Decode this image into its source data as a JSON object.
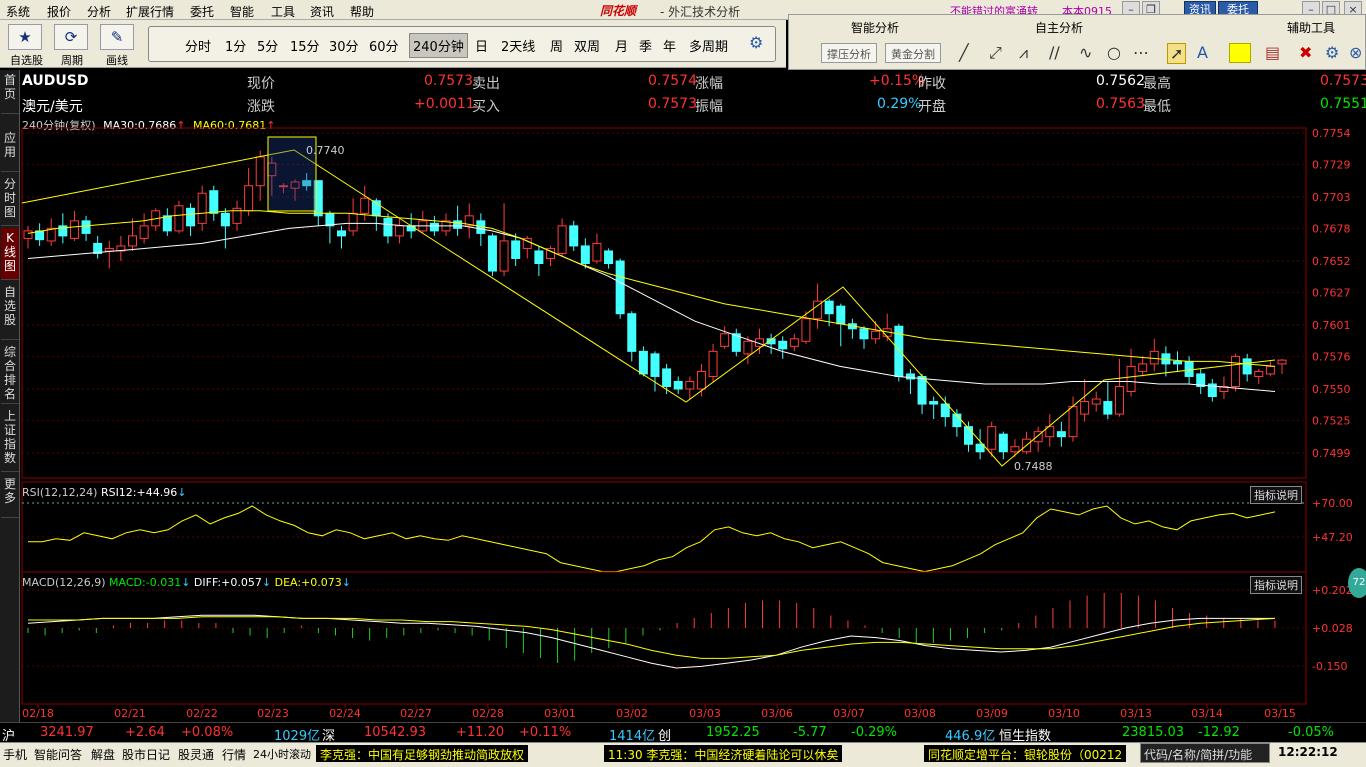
{
  "menu": {
    "items": [
      "系统",
      "报价",
      "分析",
      "扩展行情",
      "委托",
      "智能",
      "工具",
      "资讯",
      "帮助"
    ],
    "brand": "同花顺",
    "app_title": "- 外汇技术分析",
    "promo": "不能错过的富涌转",
    "account": "本本0915",
    "btn_news": "资讯",
    "btn_trade": "委托"
  },
  "toolbar": {
    "labels": [
      "自选股",
      "周期",
      "画线"
    ],
    "periods": [
      "分时",
      "1分",
      "5分",
      "15分",
      "30分",
      "60分",
      "240分钟",
      "日",
      "2天线",
      "周",
      "双周",
      "月",
      "季",
      "年",
      "多周期"
    ],
    "active": "240分钟"
  },
  "right_panel": {
    "headers": [
      "智能分析",
      "自主分析",
      "辅助工具"
    ],
    "buttons": [
      "撑压分析",
      "黄金分割"
    ]
  },
  "sidebar": {
    "tabs": [
      "首页",
      "应用",
      "分时图",
      "K线图",
      "自选股",
      "综合排名",
      "上证指数",
      "更多"
    ]
  },
  "quote": {
    "code": "AUDUSD",
    "name": "澳元/美元",
    "price_label": "现价",
    "price": "0.7573",
    "change_label": "涨跌",
    "change": "+0.0011",
    "sell_label": "卖出",
    "sell": "0.7574",
    "buy_label": "买入",
    "buy": "0.7573",
    "pct_label": "涨幅",
    "pct": "+0.15%",
    "amp_label": "振幅",
    "amp": "0.29%",
    "prev_label": "昨收",
    "prev": "0.7562",
    "open_label": "开盘",
    "open": "0.7563",
    "high_label": "最高",
    "high": "0.7573",
    "low_label": "最低",
    "low": "0.7551"
  },
  "ma": {
    "period": "240分钟(复权)",
    "ma30_label": "MA30:",
    "ma30": "0.7686",
    "ma60_label": "MA60:",
    "ma60": "0.7681"
  },
  "rsi": {
    "title": "RSI(12,12,24)",
    "line": "RSI12:",
    "value": "+44.96",
    "hint": "指标说明",
    "ticks": [
      "+70.00",
      "+47.20"
    ]
  },
  "macd": {
    "title": "MACD(12,26,9)",
    "macd_label": "MACD:",
    "macd": "-0.031",
    "diff_label": "DIFF:",
    "diff": "+0.057",
    "dea_label": "DEA:",
    "dea": "+0.073",
    "hint": "指标说明",
    "ticks": [
      "+0.202",
      "+0.028",
      "-0.150"
    ]
  },
  "chart_data": {
    "type": "candlestick",
    "ylim": [
      0.7474,
      0.7754
    ],
    "y_ticks": [
      "0.7754",
      "0.7729",
      "0.7703",
      "0.7678",
      "0.7652",
      "0.7627",
      "0.7601",
      "0.7576",
      "0.7550",
      "0.7525",
      "0.7499"
    ],
    "x_ticks": [
      "02/18",
      "02/21",
      "02/22",
      "02/23",
      "02/24",
      "02/27",
      "02/28",
      "03/01",
      "03/02",
      "03/03",
      "03/06",
      "03/07",
      "03/08",
      "03/09",
      "03/10",
      "03/13",
      "03/14",
      "03/15"
    ],
    "annotations": [
      {
        "text": "0.7740",
        "value": 0.774
      },
      {
        "text": "0.7488",
        "value": 0.7488
      }
    ],
    "candles": [
      [
        0.767,
        0.7676,
        0.7662,
        0.768
      ],
      [
        0.7676,
        0.7669,
        0.7664,
        0.7682
      ],
      [
        0.7668,
        0.7678,
        0.7664,
        0.7686
      ],
      [
        0.768,
        0.7672,
        0.7666,
        0.769
      ],
      [
        0.767,
        0.7684,
        0.7668,
        0.7692
      ],
      [
        0.7684,
        0.7674,
        0.7668,
        0.7688
      ],
      [
        0.7666,
        0.7658,
        0.7654,
        0.7672
      ],
      [
        0.766,
        0.7662,
        0.7646,
        0.7668
      ],
      [
        0.766,
        0.7664,
        0.7652,
        0.7672
      ],
      [
        0.7664,
        0.7672,
        0.766,
        0.7686
      ],
      [
        0.767,
        0.768,
        0.7666,
        0.769
      ],
      [
        0.768,
        0.7692,
        0.7676,
        0.7694
      ],
      [
        0.7688,
        0.7676,
        0.7672,
        0.7694
      ],
      [
        0.7676,
        0.7696,
        0.7674,
        0.77
      ],
      [
        0.7694,
        0.768,
        0.7672,
        0.7698
      ],
      [
        0.7682,
        0.7706,
        0.7676,
        0.7712
      ],
      [
        0.7708,
        0.769,
        0.7684,
        0.7712
      ],
      [
        0.769,
        0.768,
        0.7662,
        0.7694
      ],
      [
        0.7682,
        0.7694,
        0.7676,
        0.77
      ],
      [
        0.7692,
        0.7712,
        0.7688,
        0.7726
      ],
      [
        0.7712,
        0.7735,
        0.77,
        0.774
      ],
      [
        0.772,
        0.773,
        0.7704,
        0.7735
      ],
      [
        0.7712,
        0.7712,
        0.7706,
        0.7714
      ],
      [
        0.771,
        0.7715,
        0.77,
        0.7717
      ],
      [
        0.7716,
        0.7712,
        0.7708,
        0.7722
      ],
      [
        0.7716,
        0.7688,
        0.768,
        0.7716
      ],
      [
        0.769,
        0.768,
        0.7666,
        0.7692
      ],
      [
        0.7676,
        0.7672,
        0.7662,
        0.768
      ],
      [
        0.7676,
        0.769,
        0.7672,
        0.7702
      ],
      [
        0.769,
        0.7702,
        0.7684,
        0.7712
      ],
      [
        0.77,
        0.7688,
        0.7676,
        0.7702
      ],
      [
        0.7686,
        0.7672,
        0.7666,
        0.769
      ],
      [
        0.7672,
        0.768,
        0.7666,
        0.7686
      ],
      [
        0.768,
        0.7676,
        0.767,
        0.769
      ],
      [
        0.7676,
        0.7684,
        0.7674,
        0.7692
      ],
      [
        0.7682,
        0.7676,
        0.7672,
        0.7688
      ],
      [
        0.7676,
        0.7684,
        0.7672,
        0.769
      ],
      [
        0.7684,
        0.7678,
        0.7672,
        0.7696
      ],
      [
        0.768,
        0.7688,
        0.767,
        0.7698
      ],
      [
        0.7684,
        0.7674,
        0.7664,
        0.769
      ],
      [
        0.7672,
        0.7644,
        0.764,
        0.7674
      ],
      [
        0.7644,
        0.7668,
        0.764,
        0.7698
      ],
      [
        0.7668,
        0.7654,
        0.7648,
        0.7674
      ],
      [
        0.7662,
        0.767,
        0.7654,
        0.7672
      ],
      [
        0.766,
        0.765,
        0.764,
        0.7664
      ],
      [
        0.7654,
        0.7662,
        0.7648,
        0.7664
      ],
      [
        0.7658,
        0.768,
        0.7656,
        0.7686
      ],
      [
        0.768,
        0.7664,
        0.766,
        0.7684
      ],
      [
        0.7664,
        0.765,
        0.7646,
        0.767
      ],
      [
        0.7652,
        0.7666,
        0.765,
        0.7674
      ],
      [
        0.766,
        0.765,
        0.7646,
        0.7662
      ],
      [
        0.7652,
        0.761,
        0.7606,
        0.7654
      ],
      [
        0.761,
        0.758,
        0.7572,
        0.7612
      ],
      [
        0.758,
        0.7562,
        0.756,
        0.7584
      ],
      [
        0.7578,
        0.756,
        0.7548,
        0.758
      ],
      [
        0.7566,
        0.7552,
        0.7546,
        0.757
      ],
      [
        0.7556,
        0.755,
        0.7546,
        0.756
      ],
      [
        0.755,
        0.7556,
        0.7542,
        0.756
      ],
      [
        0.755,
        0.7564,
        0.7544,
        0.757
      ],
      [
        0.756,
        0.758,
        0.7556,
        0.7586
      ],
      [
        0.7584,
        0.7594,
        0.7582,
        0.76
      ],
      [
        0.7594,
        0.758,
        0.7576,
        0.7598
      ],
      [
        0.7578,
        0.7588,
        0.757,
        0.7592
      ],
      [
        0.7584,
        0.759,
        0.7578,
        0.7598
      ],
      [
        0.759,
        0.7586,
        0.7578,
        0.7594
      ],
      [
        0.7588,
        0.7582,
        0.7574,
        0.7592
      ],
      [
        0.7584,
        0.759,
        0.758,
        0.7594
      ],
      [
        0.7588,
        0.7606,
        0.7586,
        0.7612
      ],
      [
        0.7606,
        0.762,
        0.7598,
        0.7634
      ],
      [
        0.762,
        0.761,
        0.76,
        0.7622
      ],
      [
        0.7616,
        0.7602,
        0.7584,
        0.7618
      ],
      [
        0.7602,
        0.7598,
        0.759,
        0.7606
      ],
      [
        0.7598,
        0.759,
        0.7582,
        0.76
      ],
      [
        0.759,
        0.7596,
        0.7586,
        0.7604
      ],
      [
        0.7592,
        0.7598,
        0.7588,
        0.761
      ],
      [
        0.76,
        0.756,
        0.7556,
        0.7602
      ],
      [
        0.7562,
        0.7558,
        0.7546,
        0.7566
      ],
      [
        0.756,
        0.7538,
        0.753,
        0.7562
      ],
      [
        0.754,
        0.7538,
        0.7526,
        0.7544
      ],
      [
        0.7538,
        0.7528,
        0.752,
        0.7544
      ],
      [
        0.753,
        0.752,
        0.7512,
        0.7534
      ],
      [
        0.752,
        0.7506,
        0.75,
        0.7524
      ],
      [
        0.7506,
        0.75,
        0.7494,
        0.7518
      ],
      [
        0.7502,
        0.752,
        0.7496,
        0.7524
      ],
      [
        0.7514,
        0.75,
        0.7494,
        0.7516
      ],
      [
        0.75,
        0.7504,
        0.7496,
        0.751
      ],
      [
        0.75,
        0.751,
        0.7498,
        0.7516
      ],
      [
        0.7508,
        0.7516,
        0.75,
        0.752
      ],
      [
        0.7512,
        0.752,
        0.7504,
        0.753
      ],
      [
        0.7516,
        0.7512,
        0.7504,
        0.7524
      ],
      [
        0.7512,
        0.7536,
        0.7508,
        0.7544
      ],
      [
        0.753,
        0.754,
        0.7524,
        0.7558
      ],
      [
        0.7538,
        0.7542,
        0.7532,
        0.7548
      ],
      [
        0.754,
        0.753,
        0.7526,
        0.7556
      ],
      [
        0.753,
        0.7552,
        0.7528,
        0.7574
      ],
      [
        0.7548,
        0.7568,
        0.7544,
        0.7582
      ],
      [
        0.7564,
        0.757,
        0.756,
        0.7576
      ],
      [
        0.757,
        0.758,
        0.7564,
        0.759
      ],
      [
        0.7578,
        0.757,
        0.756,
        0.7584
      ],
      [
        0.7572,
        0.757,
        0.7564,
        0.758
      ],
      [
        0.7572,
        0.756,
        0.7554,
        0.7576
      ],
      [
        0.7562,
        0.7552,
        0.7546,
        0.7566
      ],
      [
        0.7554,
        0.7544,
        0.754,
        0.7558
      ],
      [
        0.7548,
        0.7552,
        0.7542,
        0.756
      ],
      [
        0.7552,
        0.7576,
        0.7548,
        0.7578
      ],
      [
        0.7574,
        0.7562,
        0.7556,
        0.7578
      ],
      [
        0.756,
        0.7564,
        0.7554,
        0.7566
      ],
      [
        0.7562,
        0.7568,
        0.756,
        0.7572
      ],
      [
        0.757,
        0.7573,
        0.7562,
        0.7574
      ]
    ],
    "ma30": [
      0.7654,
      0.7656,
      0.7658,
      0.766,
      0.7662,
      0.7664,
      0.7666,
      0.767,
      0.7674,
      0.7678,
      0.768,
      0.7682,
      0.7682,
      0.768,
      0.768,
      0.768,
      0.7676,
      0.767,
      0.766,
      0.765,
      0.764,
      0.7628,
      0.7616,
      0.7604,
      0.7596,
      0.7588,
      0.758,
      0.7574,
      0.7568,
      0.7564,
      0.756,
      0.7558,
      0.7556,
      0.7554,
      0.7554,
      0.7554,
      0.7556,
      0.7556,
      0.7556,
      0.7554,
      0.7554,
      0.7552,
      0.755,
      0.7548
    ],
    "ma60": [
      0.7674,
      0.7678,
      0.768,
      0.7682,
      0.7684,
      0.7688,
      0.769,
      0.7692,
      0.7692,
      0.769,
      0.769,
      0.769,
      0.7688,
      0.7686,
      0.7684,
      0.7682,
      0.7678,
      0.767,
      0.766,
      0.765,
      0.7642,
      0.7636,
      0.763,
      0.7624,
      0.7618,
      0.7614,
      0.761,
      0.7606,
      0.7602,
      0.7598,
      0.7594,
      0.759,
      0.7588,
      0.7586,
      0.7584,
      0.7582,
      0.758,
      0.7578,
      0.7576,
      0.7574,
      0.7572,
      0.7572,
      0.757,
      0.7568
    ],
    "rsi12": [
      44,
      44,
      46,
      45,
      50,
      48,
      46,
      50,
      52,
      50,
      52,
      58,
      62,
      56,
      60,
      63,
      68,
      62,
      58,
      55,
      50,
      48,
      52,
      50,
      46,
      48,
      50,
      46,
      48,
      46,
      45,
      48,
      46,
      44,
      42,
      40,
      38,
      36,
      30,
      28,
      26,
      24,
      24,
      26,
      28,
      32,
      34,
      40,
      44,
      52,
      54,
      50,
      48,
      50,
      46,
      44,
      40,
      42,
      44,
      40,
      36,
      30,
      28,
      26,
      24,
      26,
      28,
      32,
      36,
      42,
      46,
      50,
      60,
      66,
      64,
      62,
      66,
      68,
      60,
      56,
      58,
      54,
      52,
      58,
      60,
      62,
      63,
      60,
      62,
      64
    ],
    "macd_bar": [
      -0.02,
      -0.03,
      -0.02,
      -0.01,
      -0.02,
      0.01,
      0.02,
      0.02,
      0.03,
      0.03,
      0.02,
      0.02,
      -0.02,
      -0.03,
      -0.04,
      -0.02,
      0.01,
      -0.02,
      -0.03,
      -0.04,
      -0.05,
      -0.04,
      -0.03,
      -0.02,
      -0.01,
      -0.02,
      -0.03,
      -0.05,
      -0.08,
      -0.1,
      -0.12,
      -0.14,
      -0.13,
      -0.1,
      -0.08,
      -0.06,
      -0.03,
      -0.01,
      0.02,
      0.04,
      0.06,
      0.08,
      0.1,
      0.11,
      0.11,
      0.1,
      0.08,
      0.05,
      0.03,
      0.01,
      -0.02,
      -0.04,
      -0.06,
      -0.06,
      -0.05,
      -0.04,
      -0.02,
      -0.01,
      0.02,
      0.05,
      0.08,
      0.11,
      0.13,
      0.14,
      0.14,
      0.13,
      0.11,
      0.08,
      0.06,
      0.05,
      0.04,
      0.04,
      0.03,
      0.03
    ],
    "macd_diff": [
      0.03,
      0.04,
      0.05,
      0.06,
      0.06,
      0.06,
      0.07,
      0.08,
      0.08,
      0.08,
      0.07,
      0.06,
      0.06,
      0.05,
      0.04,
      0.03,
      0.03,
      0.02,
      0.01,
      -0.01,
      -0.03,
      -0.06,
      -0.1,
      -0.14,
      -0.18,
      -0.22,
      -0.25,
      -0.24,
      -0.22,
      -0.2,
      -0.17,
      -0.12,
      -0.08,
      -0.05,
      -0.06,
      -0.08,
      -0.11,
      -0.13,
      -0.14,
      -0.15,
      -0.14,
      -0.12,
      -0.08,
      -0.04,
      0.0,
      0.03,
      0.05,
      0.06,
      0.06,
      0.06,
      0.06
    ],
    "macd_dea": [
      0.05,
      0.05,
      0.05,
      0.06,
      0.06,
      0.06,
      0.06,
      0.07,
      0.07,
      0.07,
      0.07,
      0.06,
      0.06,
      0.06,
      0.05,
      0.05,
      0.04,
      0.04,
      0.03,
      0.02,
      0.01,
      -0.01,
      -0.04,
      -0.07,
      -0.1,
      -0.14,
      -0.17,
      -0.19,
      -0.19,
      -0.18,
      -0.17,
      -0.14,
      -0.12,
      -0.1,
      -0.09,
      -0.09,
      -0.1,
      -0.11,
      -0.12,
      -0.13,
      -0.13,
      -0.13,
      -0.11,
      -0.08,
      -0.05,
      -0.02,
      0.01,
      0.03,
      0.04,
      0.05,
      0.06
    ]
  },
  "status": {
    "sh": "沪",
    "sh_val": "3241.97",
    "sh_chg": "+2.64",
    "sh_pct": "+0.08%",
    "sh_amt": "1029亿",
    "sz": "深",
    "sz_val": "10542.93",
    "sz_chg": "+11.20",
    "sz_pct": "+0.11%",
    "sz_amt": "1414亿",
    "cy": "创",
    "cy_val": "1952.25",
    "cy_chg": "-5.77",
    "cy_pct": "-0.29%",
    "cy_amt": "446.9亿",
    "hs": "恒生指数",
    "hs_val": "23815.03",
    "hs_chg": "-12.92",
    "hs_pct": "-0.05%"
  },
  "bottom": {
    "tabs": [
      "手机",
      "智能问答",
      "解盘",
      "股市日记",
      "股灵通",
      "行情",
      "24小时滚动"
    ],
    "news1": "李克强：中国有足够钢劲推动简政放权",
    "news2": "11:30 李克强：中国经济硬着陆论可以休矣",
    "news3": "同花顺定增平台：银轮股份（00212",
    "code_hint": "代码/名称/简拼/功能",
    "clock": "12:22:12",
    "badge": "72"
  }
}
